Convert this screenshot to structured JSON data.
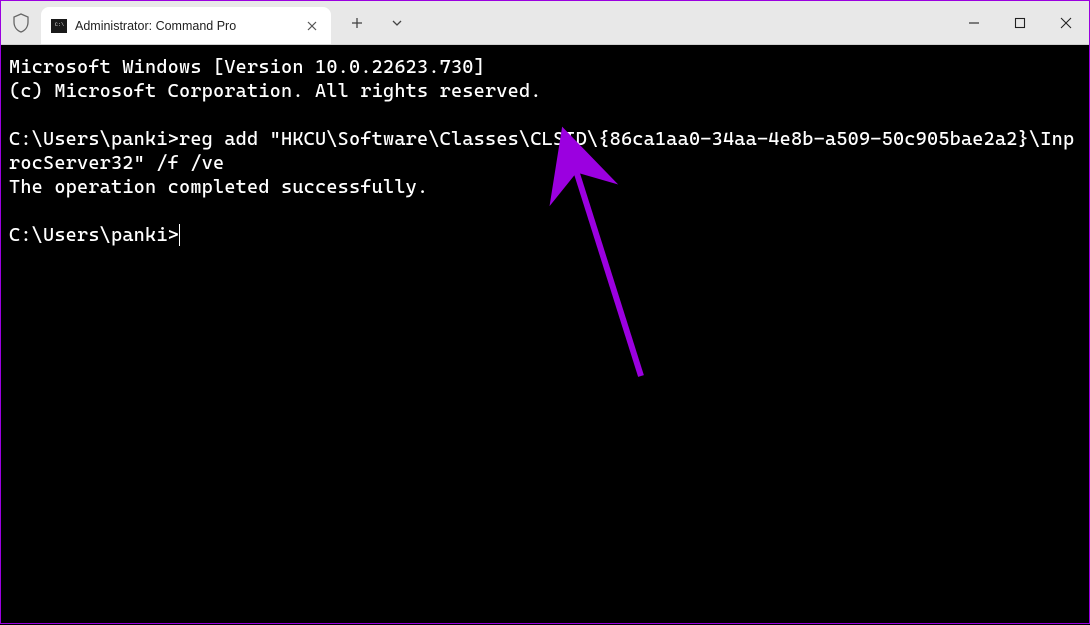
{
  "tab": {
    "title": "Administrator: Command Pro"
  },
  "window_controls": {
    "minimize": "−",
    "maximize": "□",
    "close": "✕"
  },
  "tab_buttons": {
    "new": "+",
    "dropdown": "⌄"
  },
  "terminal": {
    "line1": "Microsoft Windows [Version 10.0.22623.730]",
    "line2": "(c) Microsoft Corporation. All rights reserved.",
    "prompt1": "C:\\Users\\panki>",
    "command": "reg add \"HKCU\\Software\\Classes\\CLSID\\{86ca1aa0-34aa-4e8b-a509-50c905bae2a2}\\InprocServer32\" /f /ve",
    "result": "The operation completed successfully.",
    "prompt2": "C:\\Users\\panki>"
  },
  "annotation": {
    "color": "#9b00e0"
  }
}
